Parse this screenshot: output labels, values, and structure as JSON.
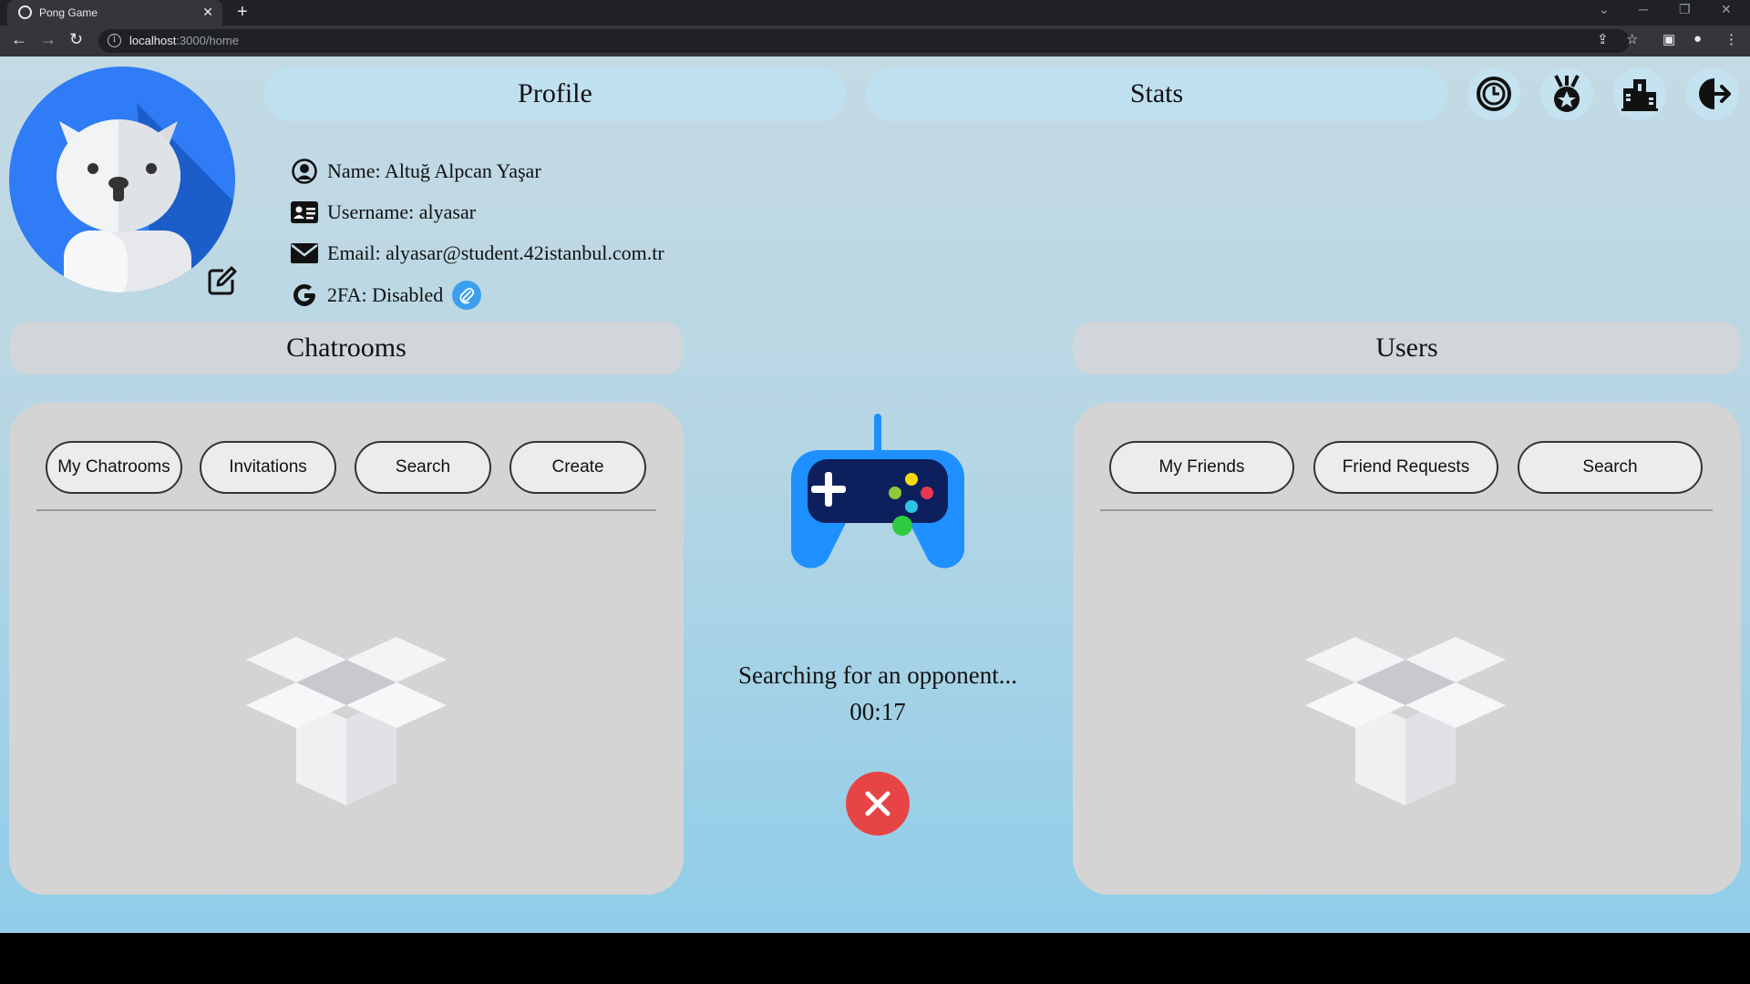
{
  "browser": {
    "tab_title": "Pong Game",
    "tab_close": "✕",
    "new_tab": "+",
    "url_host": "localhost",
    "url_rest": ":3000/home"
  },
  "header": {
    "profile_label": "Profile",
    "stats_label": "Stats",
    "nav_icons": [
      "history-icon",
      "achievements-icon",
      "leaderboard-icon",
      "logout-icon"
    ]
  },
  "profile": {
    "name": "Name: Altuğ Alpcan Yaşar",
    "username": "Username: alyasar",
    "email": "Email: alyasar@student.42istanbul.com.tr",
    "twofa": "2FA: Disabled"
  },
  "chatrooms": {
    "title": "Chatrooms",
    "buttons": [
      "My Chatrooms",
      "Invitations",
      "Search",
      "Create"
    ]
  },
  "users": {
    "title": "Users",
    "buttons": [
      "My Friends",
      "Friend Requests",
      "Search"
    ]
  },
  "matchmaking": {
    "status": "Searching for an opponent...",
    "timer": "00:17"
  },
  "colors": {
    "avatar_bg": "#2f7cf6",
    "header_pill": "#bfe0ef",
    "panel_bg": "#d4d4d4",
    "cancel": "#e74545",
    "gamepad_blue": "#1e90ff"
  }
}
